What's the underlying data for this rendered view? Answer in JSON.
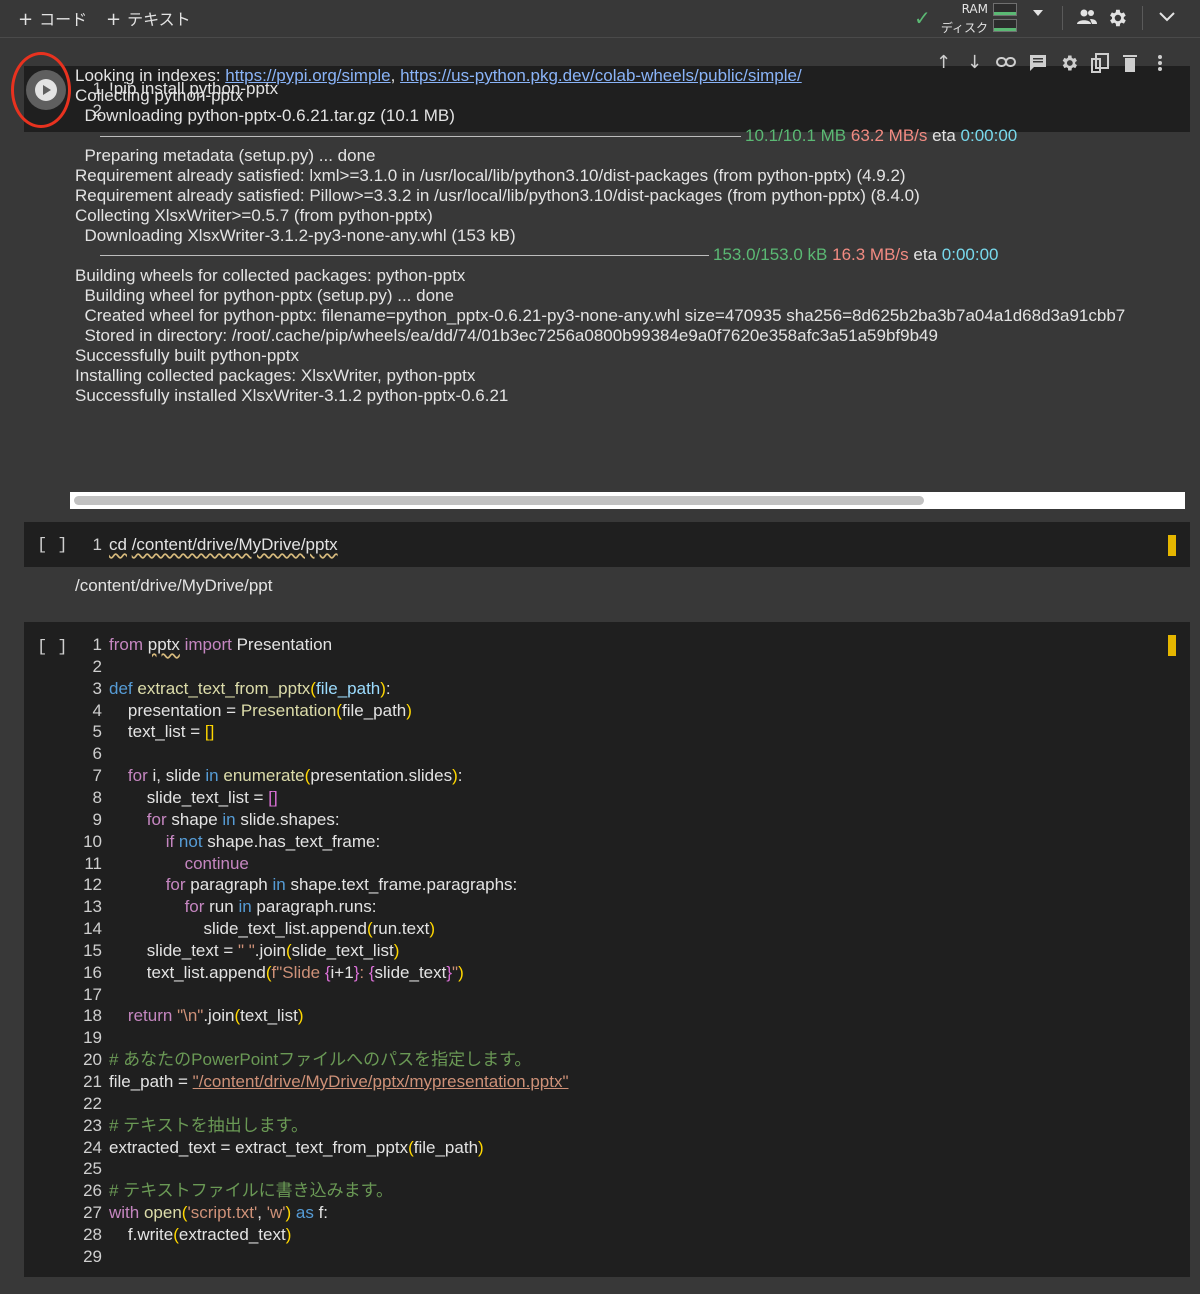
{
  "toolbar": {
    "add_code": "コード",
    "add_text": "テキスト",
    "plus": "+",
    "ram_label": "RAM",
    "disk_label": "ディスク"
  },
  "cell1": {
    "code": [
      "!pip install python-pptx",
      ""
    ],
    "output": {
      "l1_prefix": "Looking in indexes: ",
      "l1_link1": "https://pypi.org/simple",
      "l1_sep": ", ",
      "l1_link2": "https://us-python.pkg.dev/colab-wheels/public/simple/",
      "l2": "Collecting python-pptx",
      "l3": "  Downloading python-pptx-0.6.21.tar.gz (10.1 MB)",
      "p1_size": "10.1/10.1 MB",
      "p1_speed": "63.2 MB/s",
      "p1_eta_label": "eta",
      "p1_eta": "0:00:00",
      "l5": "  Preparing metadata (setup.py) ... done",
      "l6": "Requirement already satisfied: lxml>=3.1.0 in /usr/local/lib/python3.10/dist-packages (from python-pptx) (4.9.2)",
      "l7": "Requirement already satisfied: Pillow>=3.3.2 in /usr/local/lib/python3.10/dist-packages (from python-pptx) (8.4.0)",
      "l8": "Collecting XlsxWriter>=0.5.7 (from python-pptx)",
      "l9": "  Downloading XlsxWriter-3.1.2-py3-none-any.whl (153 kB)",
      "p2_size": "153.0/153.0 kB",
      "p2_speed": "16.3 MB/s",
      "p2_eta_label": "eta",
      "p2_eta": "0:00:00",
      "l11": "Building wheels for collected packages: python-pptx",
      "l12": "  Building wheel for python-pptx (setup.py) ... done",
      "l13": "  Created wheel for python-pptx: filename=python_pptx-0.6.21-py3-none-any.whl size=470935 sha256=8d625b2ba3b7a04a1d68d3a91cbb7",
      "l14": "  Stored in directory: /root/.cache/pip/wheels/ea/dd/74/01b3ec7256a0800b99384e9a0f7620e358afc3a51a59bf9b49",
      "l15": "Successfully built python-pptx",
      "l16": "Installing collected packages: XlsxWriter, python-pptx",
      "l17": "Successfully installed XlsxWriter-3.1.2 python-pptx-0.6.21"
    }
  },
  "cell2": {
    "bracket": "[ ]",
    "cmd": "cd",
    "path": "/content/drive/MyDrive/pptx",
    "output": "/content/drive/MyDrive/ppt"
  },
  "cell3": {
    "bracket": "[ ]",
    "lines": [
      [
        [
          "from",
          "kw"
        ],
        [
          " ",
          ""
        ],
        [
          "pptx",
          "wavy"
        ],
        [
          " ",
          ""
        ],
        [
          "import",
          "kw"
        ],
        [
          " Presentation",
          ""
        ]
      ],
      [],
      [
        [
          "def",
          "kw2"
        ],
        [
          " ",
          ""
        ],
        [
          "extract_text_from_pptx",
          "fn"
        ],
        [
          "(",
          "br1"
        ],
        [
          "file_path",
          "var"
        ],
        [
          ")",
          "br1"
        ],
        [
          ":",
          ""
        ]
      ],
      [
        [
          "    presentation = ",
          ""
        ],
        [
          "Presentation",
          "fn"
        ],
        [
          "(",
          "br1"
        ],
        [
          "file_path",
          ""
        ],
        [
          ")",
          "br1"
        ]
      ],
      [
        [
          "    text_list = ",
          ""
        ],
        [
          "[]",
          "br1"
        ]
      ],
      [],
      [
        [
          "    ",
          ""
        ],
        [
          "for",
          "kw"
        ],
        [
          " i, slide ",
          ""
        ],
        [
          "in",
          "kw2"
        ],
        [
          " ",
          ""
        ],
        [
          "enumerate",
          "fn"
        ],
        [
          "(",
          "br1"
        ],
        [
          "presentation.slides",
          ""
        ],
        [
          ")",
          "br1"
        ],
        [
          ":",
          ""
        ]
      ],
      [
        [
          "        slide_text_list = ",
          ""
        ],
        [
          "[]",
          "br2"
        ]
      ],
      [
        [
          "        ",
          ""
        ],
        [
          "for",
          "kw"
        ],
        [
          " shape ",
          ""
        ],
        [
          "in",
          "kw2"
        ],
        [
          " slide.shapes:",
          ""
        ]
      ],
      [
        [
          "            ",
          ""
        ],
        [
          "if",
          "kw"
        ],
        [
          " ",
          ""
        ],
        [
          "not",
          "kw2"
        ],
        [
          " shape.has_text_frame:",
          ""
        ]
      ],
      [
        [
          "                ",
          ""
        ],
        [
          "continue",
          "kw"
        ]
      ],
      [
        [
          "            ",
          ""
        ],
        [
          "for",
          "kw"
        ],
        [
          " paragraph ",
          ""
        ],
        [
          "in",
          "kw2"
        ],
        [
          " shape.text_frame.paragraphs:",
          ""
        ]
      ],
      [
        [
          "                ",
          ""
        ],
        [
          "for",
          "kw"
        ],
        [
          " run ",
          ""
        ],
        [
          "in",
          "kw2"
        ],
        [
          " paragraph.runs:",
          ""
        ]
      ],
      [
        [
          "                    slide_text_list.append",
          ""
        ],
        [
          "(",
          "br1"
        ],
        [
          "run.text",
          ""
        ],
        [
          ")",
          "br1"
        ]
      ],
      [
        [
          "        slide_text = ",
          ""
        ],
        [
          "\" \"",
          "str"
        ],
        [
          ".join",
          ""
        ],
        [
          "(",
          "br1"
        ],
        [
          "slide_text_list",
          ""
        ],
        [
          ")",
          "br1"
        ]
      ],
      [
        [
          "        text_list.append",
          ""
        ],
        [
          "(",
          "br1"
        ],
        [
          "f\"Slide ",
          "str"
        ],
        [
          "{",
          "br2"
        ],
        [
          "i+1",
          ""
        ],
        [
          "}",
          "br2"
        ],
        [
          ": ",
          "str"
        ],
        [
          "{",
          "br2"
        ],
        [
          "slide_text",
          ""
        ],
        [
          "}",
          "br2"
        ],
        [
          "\"",
          "str"
        ],
        [
          ")",
          "br1"
        ]
      ],
      [],
      [
        [
          "    ",
          ""
        ],
        [
          "return",
          "kw"
        ],
        [
          " ",
          ""
        ],
        [
          "\"\\n\"",
          "str"
        ],
        [
          ".join",
          ""
        ],
        [
          "(",
          "br1"
        ],
        [
          "text_list",
          ""
        ],
        [
          ")",
          "br1"
        ]
      ],
      [],
      [
        [
          "# あなたのPowerPointファイルへのパスを指定します。",
          "cmt"
        ]
      ],
      [
        [
          "file_path = ",
          ""
        ],
        [
          "\"/content/drive/MyDrive/pptx/mypresentation.pptx\"",
          "strlink"
        ]
      ],
      [],
      [
        [
          "# テキストを抽出します。",
          "cmt"
        ]
      ],
      [
        [
          "extracted_text = extract_text_from_pptx",
          ""
        ],
        [
          "(",
          "br1"
        ],
        [
          "file_path",
          ""
        ],
        [
          ")",
          "br1"
        ]
      ],
      [],
      [
        [
          "# テキストファイルに書き込みます。",
          "cmt"
        ]
      ],
      [
        [
          "with",
          "kw"
        ],
        [
          " ",
          ""
        ],
        [
          "open",
          "fn"
        ],
        [
          "(",
          "br1"
        ],
        [
          "'script.txt'",
          "str"
        ],
        [
          ", ",
          ""
        ],
        [
          "'w'",
          "str"
        ],
        [
          ")",
          "br1"
        ],
        [
          " ",
          ""
        ],
        [
          "as",
          "kw2"
        ],
        [
          " f:",
          ""
        ]
      ],
      [
        [
          "    f.write",
          ""
        ],
        [
          "(",
          "br1"
        ],
        [
          "extracted_text",
          ""
        ],
        [
          ")",
          "br1"
        ]
      ],
      []
    ]
  }
}
